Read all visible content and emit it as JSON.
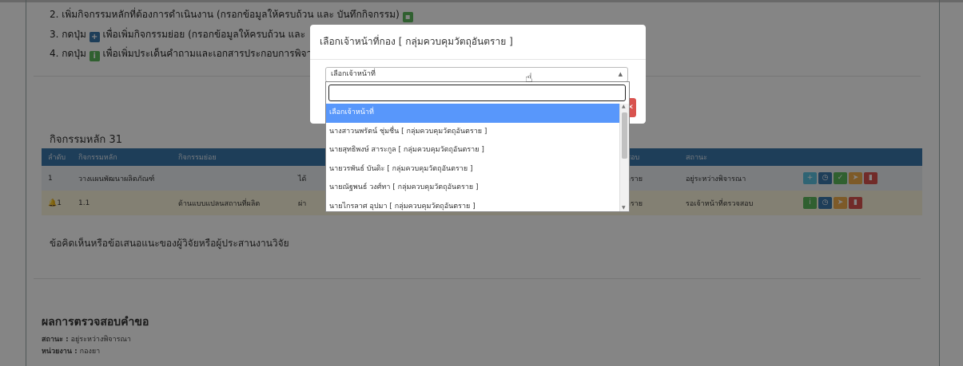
{
  "steps": [
    "2. เพิ่มกิจกรรมหลักที่ต้องการดำเนินงาน (กรอกข้อมูลให้ครบถ้วน และ บันทึกกิจกรรม)",
    "3. กดปุ่ม",
    "เพื่อเพิ่มกิจกรรมย่อย (กรอกข้อมูลให้ครบถ้วน และ",
    "4. กดปุ่ม",
    "เพื่อเพิ่มประเด็นคำถามและเอกสารประกอบการพิจาร"
  ],
  "activities": {
    "title": "กิจกรรมหลัก 31",
    "headers": [
      "ลำดับ",
      "กิจกรรมหลัก",
      "กิจกรรมย่อย",
      "",
      "ชอบ",
      "สถานะ",
      ""
    ],
    "rows": [
      {
        "no": "1",
        "main": "วางแผนพัฒนาผลิตภัณฑ์",
        "sub": "",
        "col4": "ได้",
        "resp": "ตราย",
        "status": "อยู่ระหว่างพิจารณา"
      },
      {
        "no": "1",
        "main": "1.1",
        "sub": "ด้านแบบแปลนสถานที่ผลิต",
        "col4": "ผ่า",
        "resp": "ตราย",
        "status": "รอเจ้าหน้าที่ตรวจสอบ"
      }
    ]
  },
  "comment_label": "ข้อคิดเห็นหรือข้อเสนอแนะของผู้วิจัยหรือผู้ประสานงานวิจัย",
  "result": {
    "title": "ผลการตรวจสอบคำขอ",
    "status_label": "สถานะ :",
    "status_value": "อยู่ระหว่างพิจารณา",
    "unit_label": "หน่วยงาน :",
    "unit_value": "กองยา"
  },
  "modal": {
    "title": "เลือกเจ้าหน้าที่กอง [ กลุ่มควบคุมวัตถุอันตราย ]",
    "select_value": "เลือกเจ้าหน้าที่",
    "options": [
      "เลือกเจ้าหน้าที่",
      "นางสาวนพรัตน์ ชุ่มชื่น [ กลุ่มควบคุมวัตถุอันตราย ]",
      "นายสุทธิพงษ์ สาระกูล [ กลุ่มควบคุมวัตถุอันตราย ]",
      "นายวรพันธ์ บันดิะ [ กลุ่มควบคุมวัตถุอันตราย ]",
      "นายณัฐพนธ์ วงศ์ทา [ กลุ่มควบคุมวัตถุอันตราย ]",
      "นายไกรลาศ อุปมา [ กลุ่มควบคุมวัตถุอันตราย ]"
    ],
    "selected_index": 0
  },
  "colors": {
    "header_blue": "#3a77ab",
    "selected_option": "#5897fb",
    "btn_add": "#5bc0de",
    "btn_timer": "#3a77ab",
    "btn_check": "#5cb85c",
    "btn_send": "#f0ad4e",
    "btn_delete": "#d9534f"
  },
  "icons": [
    "save-icon",
    "plus-icon",
    "info-icon",
    "clock-icon",
    "check-icon",
    "send-icon",
    "trash-icon",
    "bell-icon",
    "hand-cursor-icon"
  ]
}
